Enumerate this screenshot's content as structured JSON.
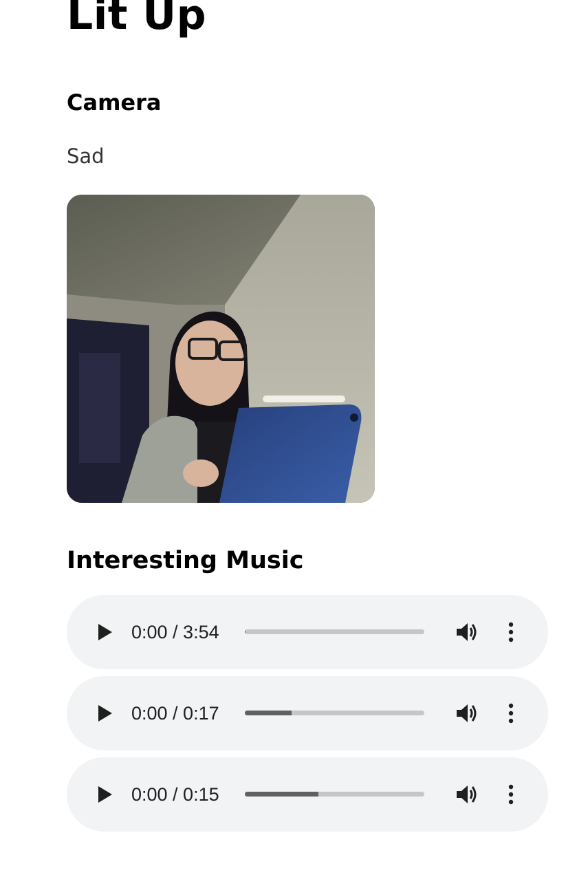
{
  "app": {
    "title": "Lit Up"
  },
  "camera": {
    "heading": "Camera",
    "mood": "Sad"
  },
  "music": {
    "heading": "Interesting Music",
    "players": [
      {
        "time_display": "0:00 / 3:54",
        "progress_fraction": 0.005
      },
      {
        "time_display": "0:00 / 0:17",
        "progress_fraction": 0.26
      },
      {
        "time_display": "0:00 / 0:15",
        "progress_fraction": 0.41
      }
    ]
  },
  "icons": {
    "play": "play-icon",
    "volume": "volume-icon",
    "more": "more-vertical-icon"
  },
  "colors": {
    "player_background": "#f1f3f4",
    "track_background": "#c4c6c8",
    "track_fill": "#5f6061",
    "icon": "#1f1f1f"
  }
}
